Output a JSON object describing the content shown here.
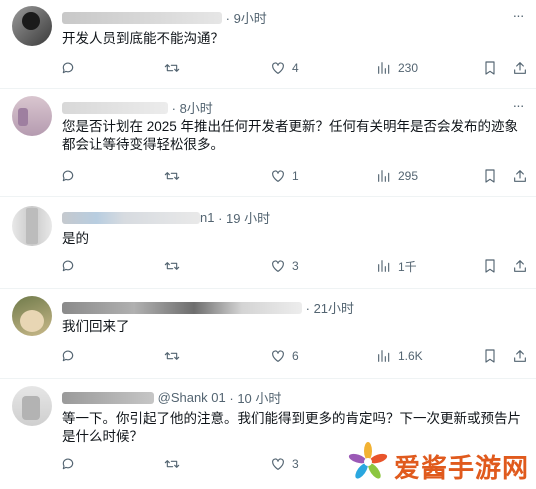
{
  "posts": [
    {
      "time": "· 9小时",
      "content": "开发人员到底能不能沟通？",
      "reply": "",
      "retweet": "",
      "likes": "4",
      "views": "230",
      "header_frag": ""
    },
    {
      "time": "· 8小时",
      "content": "您是否计划在 2025 年推出任何开发者更新？任何有关明年是否会发布的迹象都会让等待变得轻松很多。",
      "reply": "",
      "retweet": "",
      "likes": "1",
      "views": "295",
      "header_frag": ""
    },
    {
      "time": "· 19 小时",
      "content": "是的",
      "reply": "",
      "retweet": "",
      "likes": "3",
      "views": "1千",
      "header_frag": "n1"
    },
    {
      "time": "· 21小时",
      "content": "我们回来了",
      "reply": "",
      "retweet": "",
      "likes": "6",
      "views": "1.6K",
      "header_frag": ""
    },
    {
      "time": "· 10 小时",
      "content": "等一下。你引起了他的注意。我们能得到更多的肯定吗？下一次更新或预告片是什么时候？",
      "reply": "",
      "retweet": "",
      "likes": "3",
      "views": "",
      "header_frag": "@Shank 01"
    }
  ],
  "icons": {
    "reply": "reply-icon",
    "retweet": "retweet-icon",
    "like": "heart-icon",
    "views": "views-icon",
    "bookmark": "bookmark-icon",
    "share": "share-icon",
    "more": "more-icon"
  },
  "watermark": {
    "text": "爱酱手游网"
  },
  "colors": {
    "text": "#0f1419",
    "secondary": "#536471",
    "divider": "#eff3f4",
    "watermark": "#e05a1d"
  }
}
